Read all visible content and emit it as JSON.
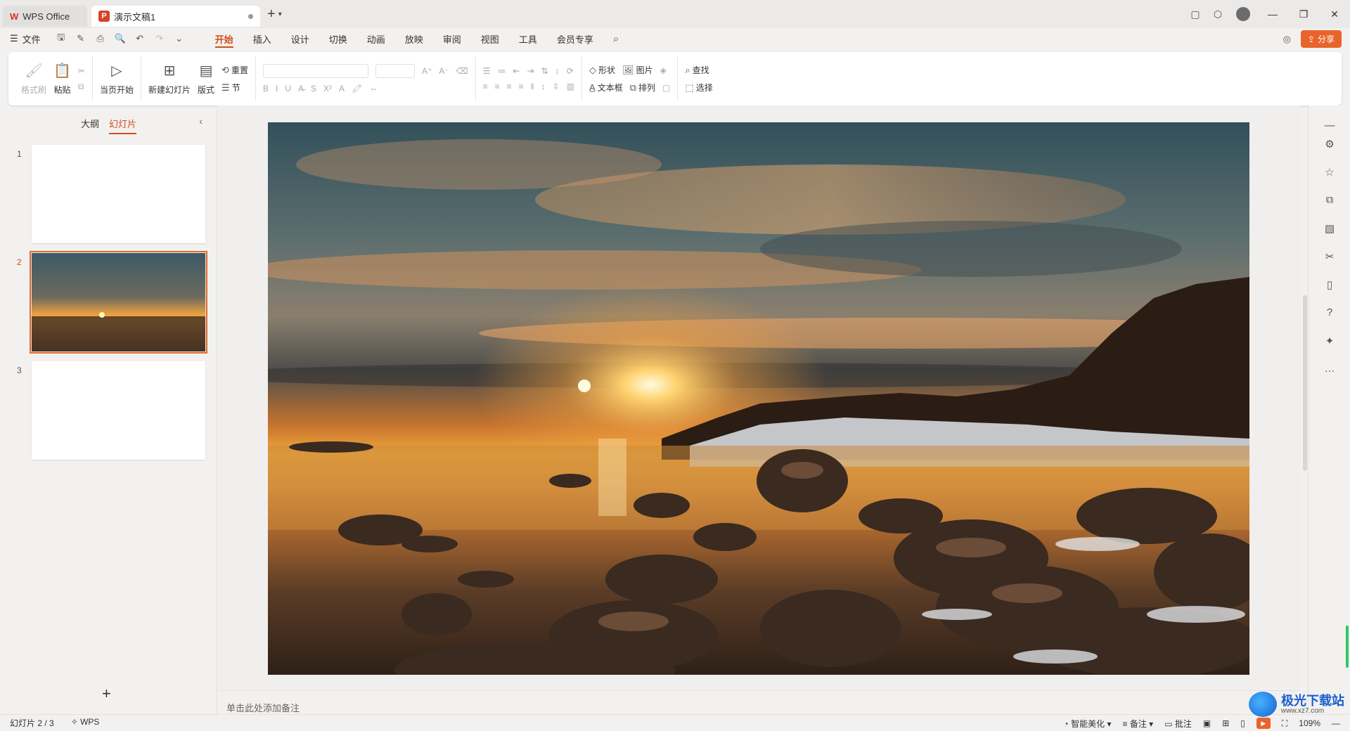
{
  "titlebar": {
    "home_tab": "WPS Office",
    "doc_tab": "演示文稿1"
  },
  "menu": {
    "file": "文件",
    "tabs": [
      "开始",
      "插入",
      "设计",
      "切换",
      "动画",
      "放映",
      "审阅",
      "视图",
      "工具",
      "会员专享"
    ],
    "active_tab": "开始",
    "share": "分享"
  },
  "ribbon": {
    "format_painter": "格式刷",
    "paste": "粘贴",
    "from_current": "当页开始",
    "new_slide": "新建幻灯片",
    "layout": "版式",
    "reset": "重置",
    "section": "节",
    "shape": "形状",
    "picture": "图片",
    "textbox": "文本框",
    "arrange": "排列",
    "find": "查找",
    "select": "选择"
  },
  "left_panel": {
    "tab_outline": "大纲",
    "tab_slides": "幻灯片",
    "slides": [
      {
        "num": "1",
        "selected": false
      },
      {
        "num": "2",
        "selected": true
      },
      {
        "num": "3",
        "selected": false
      }
    ]
  },
  "notes_placeholder": "单击此处添加备注",
  "statusbar": {
    "slide_pos": "幻灯片 2 / 3",
    "wps": "WPS",
    "beautify": "智能美化",
    "notes": "备注",
    "comments": "批注",
    "zoom": "109%"
  },
  "watermark": {
    "title": "极光下载站",
    "url": "www.xz7.com"
  },
  "colors": {
    "accent": "#d0501b",
    "share_bg": "#e8642c"
  }
}
